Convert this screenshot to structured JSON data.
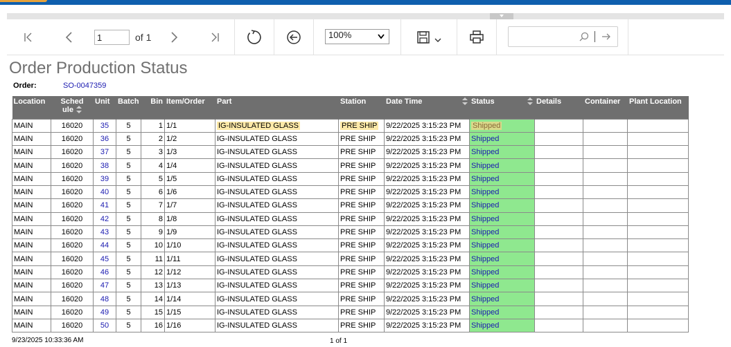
{
  "toolbar": {
    "page_value": "1",
    "page_of": "of 1",
    "zoom_selected": "100%",
    "search_placeholder": ""
  },
  "report": {
    "title": "Order Production Status",
    "order_label": "Order:",
    "order_value": "SO-0047359"
  },
  "table": {
    "headers": {
      "location": "Location",
      "schedule": "Sched\nule",
      "unit": "Unit",
      "batch": "Batch",
      "bin": "Bin",
      "item_order": "Item/Order",
      "part": "Part",
      "station": "Station",
      "date_time": "Date Time",
      "status": "Status",
      "details": "Details",
      "container": "Container",
      "plant_location": "Plant Location"
    },
    "rows": [
      {
        "location": "MAIN",
        "schedule": "16020",
        "unit": "35",
        "batch": "5",
        "bin": "1",
        "item_order": "1/1",
        "part": "IG-INSULATED GLASS",
        "station": "PRE SHIP",
        "date_time": "9/22/2025 3:15:23 PM",
        "status": "Shipped"
      },
      {
        "location": "MAIN",
        "schedule": "16020",
        "unit": "36",
        "batch": "5",
        "bin": "2",
        "item_order": "1/2",
        "part": "IG-INSULATED GLASS",
        "station": "PRE SHIP",
        "date_time": "9/22/2025 3:15:23 PM",
        "status": "Shipped"
      },
      {
        "location": "MAIN",
        "schedule": "16020",
        "unit": "37",
        "batch": "5",
        "bin": "3",
        "item_order": "1/3",
        "part": "IG-INSULATED GLASS",
        "station": "PRE SHIP",
        "date_time": "9/22/2025 3:15:23 PM",
        "status": "Shipped"
      },
      {
        "location": "MAIN",
        "schedule": "16020",
        "unit": "38",
        "batch": "5",
        "bin": "4",
        "item_order": "1/4",
        "part": "IG-INSULATED GLASS",
        "station": "PRE SHIP",
        "date_time": "9/22/2025 3:15:23 PM",
        "status": "Shipped"
      },
      {
        "location": "MAIN",
        "schedule": "16020",
        "unit": "39",
        "batch": "5",
        "bin": "5",
        "item_order": "1/5",
        "part": "IG-INSULATED GLASS",
        "station": "PRE SHIP",
        "date_time": "9/22/2025 3:15:23 PM",
        "status": "Shipped"
      },
      {
        "location": "MAIN",
        "schedule": "16020",
        "unit": "40",
        "batch": "5",
        "bin": "6",
        "item_order": "1/6",
        "part": "IG-INSULATED GLASS",
        "station": "PRE SHIP",
        "date_time": "9/22/2025 3:15:23 PM",
        "status": "Shipped"
      },
      {
        "location": "MAIN",
        "schedule": "16020",
        "unit": "41",
        "batch": "5",
        "bin": "7",
        "item_order": "1/7",
        "part": "IG-INSULATED GLASS",
        "station": "PRE SHIP",
        "date_time": "9/22/2025 3:15:23 PM",
        "status": "Shipped"
      },
      {
        "location": "MAIN",
        "schedule": "16020",
        "unit": "42",
        "batch": "5",
        "bin": "8",
        "item_order": "1/8",
        "part": "IG-INSULATED GLASS",
        "station": "PRE SHIP",
        "date_time": "9/22/2025 3:15:23 PM",
        "status": "Shipped"
      },
      {
        "location": "MAIN",
        "schedule": "16020",
        "unit": "43",
        "batch": "5",
        "bin": "9",
        "item_order": "1/9",
        "part": "IG-INSULATED GLASS",
        "station": "PRE SHIP",
        "date_time": "9/22/2025 3:15:23 PM",
        "status": "Shipped"
      },
      {
        "location": "MAIN",
        "schedule": "16020",
        "unit": "44",
        "batch": "5",
        "bin": "10",
        "item_order": "1/10",
        "part": "IG-INSULATED GLASS",
        "station": "PRE SHIP",
        "date_time": "9/22/2025 3:15:23 PM",
        "status": "Shipped"
      },
      {
        "location": "MAIN",
        "schedule": "16020",
        "unit": "45",
        "batch": "5",
        "bin": "11",
        "item_order": "1/11",
        "part": "IG-INSULATED GLASS",
        "station": "PRE SHIP",
        "date_time": "9/22/2025 3:15:23 PM",
        "status": "Shipped"
      },
      {
        "location": "MAIN",
        "schedule": "16020",
        "unit": "46",
        "batch": "5",
        "bin": "12",
        "item_order": "1/12",
        "part": "IG-INSULATED GLASS",
        "station": "PRE SHIP",
        "date_time": "9/22/2025 3:15:23 PM",
        "status": "Shipped"
      },
      {
        "location": "MAIN",
        "schedule": "16020",
        "unit": "47",
        "batch": "5",
        "bin": "13",
        "item_order": "1/13",
        "part": "IG-INSULATED GLASS",
        "station": "PRE SHIP",
        "date_time": "9/22/2025 3:15:23 PM",
        "status": "Shipped"
      },
      {
        "location": "MAIN",
        "schedule": "16020",
        "unit": "48",
        "batch": "5",
        "bin": "14",
        "item_order": "1/14",
        "part": "IG-INSULATED GLASS",
        "station": "PRE SHIP",
        "date_time": "9/22/2025 3:15:23 PM",
        "status": "Shipped"
      },
      {
        "location": "MAIN",
        "schedule": "16020",
        "unit": "49",
        "batch": "5",
        "bin": "15",
        "item_order": "1/15",
        "part": "IG-INSULATED GLASS",
        "station": "PRE SHIP",
        "date_time": "9/22/2025 3:15:23 PM",
        "status": "Shipped"
      },
      {
        "location": "MAIN",
        "schedule": "16020",
        "unit": "50",
        "batch": "5",
        "bin": "16",
        "item_order": "1/16",
        "part": "IG-INSULATED GLASS",
        "station": "PRE SHIP",
        "date_time": "9/22/2025 3:15:23 PM",
        "status": "Shipped"
      }
    ]
  },
  "footer": {
    "timestamp": "9/23/2025 10:33:36 AM",
    "page": "1 of 1"
  },
  "colors": {
    "header_bg": "#6f6f6f",
    "status_bg": "#8fe88f",
    "link": "#1a1ab0",
    "topbar": "#0f5fae",
    "highlight": "#fde9a8"
  }
}
